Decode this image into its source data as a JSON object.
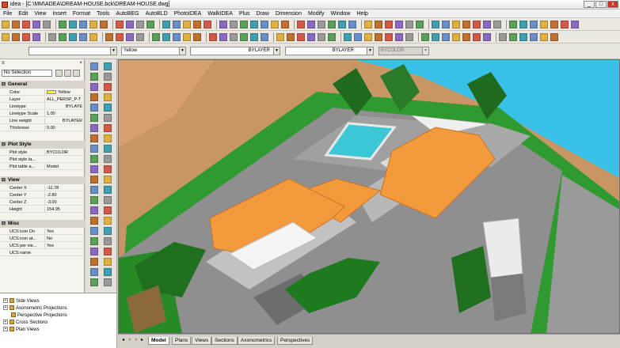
{
  "window": {
    "title": "idea - [C:\\MM\\ADEA\\DREAM-HOUSE.bck\\DREAM-HOUSE.dwg]",
    "min": "_",
    "max": "□",
    "close": "x"
  },
  "menu": [
    "File",
    "Edit",
    "View",
    "Insert",
    "Format",
    "Tools",
    "AutoBEG",
    "AutoBLD",
    "PhotoIDEA",
    "WalkIDEA",
    "Plus",
    "Draw",
    "Dimension",
    "Modify",
    "Window",
    "Help"
  ],
  "property_bar": {
    "layer_combo": "",
    "color_combo": "Yellow",
    "linetype_combo": "BYLAYER",
    "lineweight_combo": "BYLAYER",
    "plotstyle_combo": "BYCOLOR"
  },
  "properties": {
    "selection": "No Selection",
    "sections": [
      {
        "title": "General",
        "rows": [
          {
            "key": "Color",
            "value": "Yellow",
            "swatch": "#ffff00"
          },
          {
            "key": "Layer",
            "value": "ALL_PERSP_P-T"
          },
          {
            "key": "Linetype",
            "value": "BYLAYE"
          },
          {
            "key": "Linetype Scale",
            "value": "1.00"
          },
          {
            "key": "Line weight",
            "value": "BYLAYER"
          },
          {
            "key": "Thickness",
            "value": "0.00"
          }
        ]
      },
      {
        "title": "Plot Style",
        "rows": [
          {
            "key": "Plot style",
            "value": "BYCOLOR"
          },
          {
            "key": "Plot style ta...",
            "value": ""
          },
          {
            "key": "Plot table a...",
            "value": "Model"
          }
        ]
      },
      {
        "title": "View",
        "rows": [
          {
            "key": "Center X",
            "value": "-11.78"
          },
          {
            "key": "Center Y",
            "value": "-2.80"
          },
          {
            "key": "Center Z",
            "value": "-3.00"
          },
          {
            "key": "Height",
            "value": "154.95"
          }
        ]
      },
      {
        "title": "Misc",
        "rows": [
          {
            "key": "UCS icon On",
            "value": "Yes"
          },
          {
            "key": "UCS icon at...",
            "value": "No"
          },
          {
            "key": "UCS per vie...",
            "value": "Yes"
          },
          {
            "key": "UCS name",
            "value": ""
          }
        ]
      }
    ]
  },
  "tree": [
    "Side Views",
    "Axonometric Projections",
    "Perspective Projections",
    "Cross Sections",
    "Plan Views"
  ],
  "tabs": [
    "Model",
    "Plans",
    "Views",
    "Sections",
    "Axonometrics",
    "Perspectives"
  ],
  "active_tab": "Model",
  "colors": {
    "roof": "#f39a3c",
    "pool": "#3cc7d6",
    "grass": "#2f9a2f",
    "sea": "#39c0e6",
    "sand": "#c89664"
  }
}
